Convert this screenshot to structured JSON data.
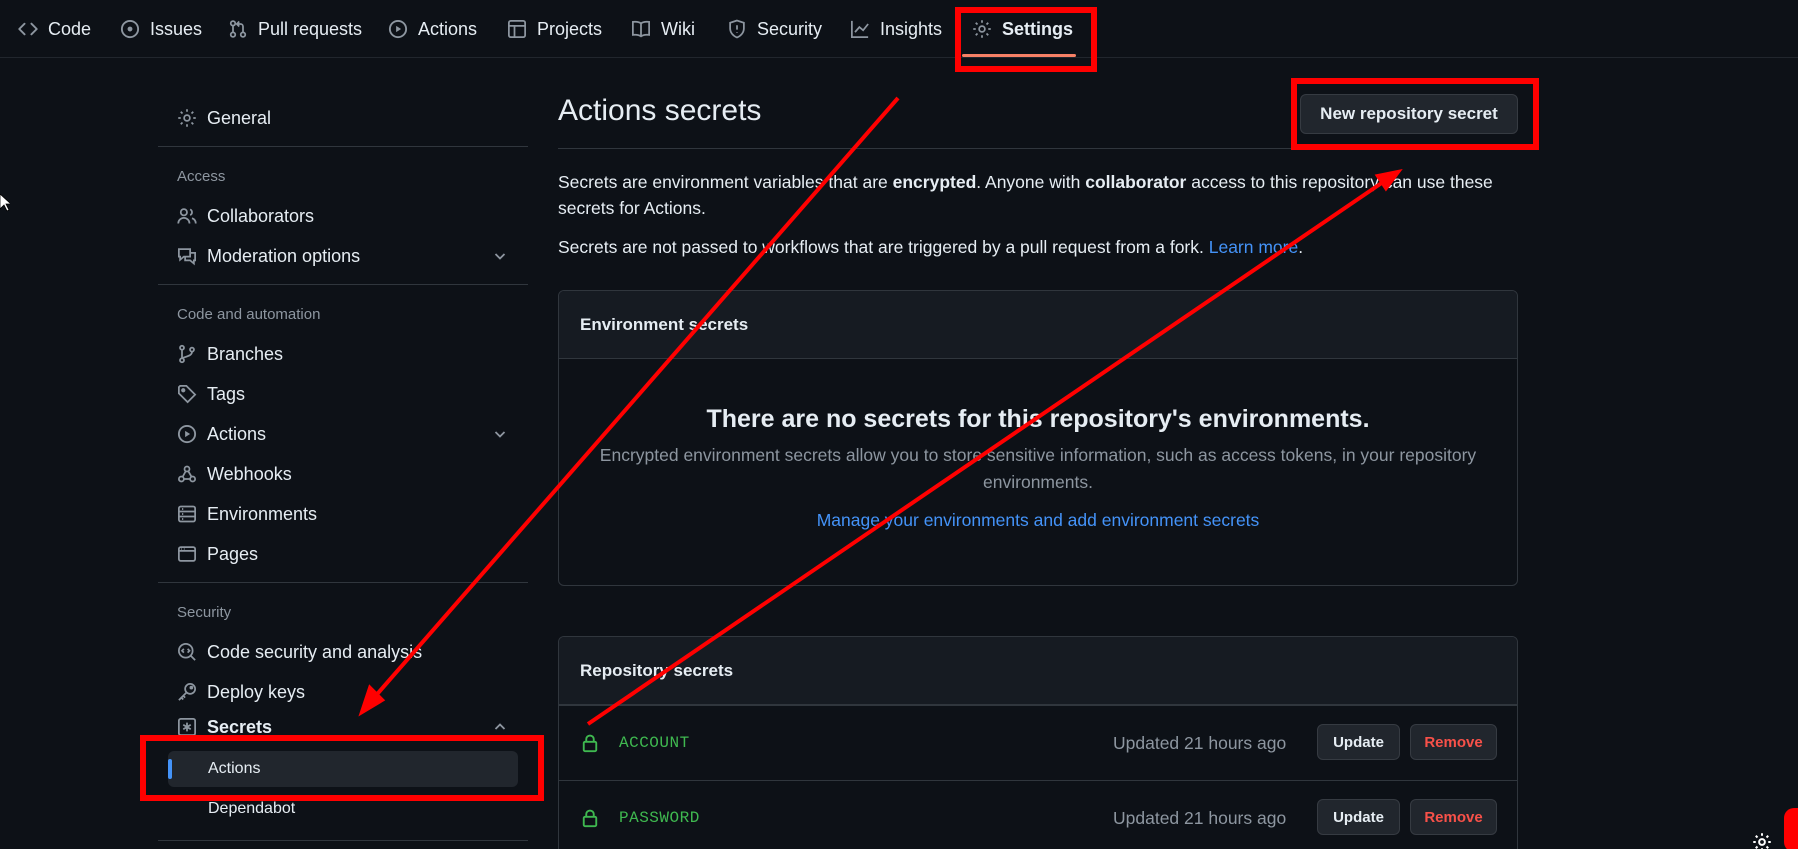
{
  "nav": {
    "tabs": [
      {
        "label": "Code",
        "icon": "code-icon"
      },
      {
        "label": "Issues",
        "icon": "issue-opened-icon"
      },
      {
        "label": "Pull requests",
        "icon": "git-pull-request-icon"
      },
      {
        "label": "Actions",
        "icon": "play-icon"
      },
      {
        "label": "Projects",
        "icon": "table-icon"
      },
      {
        "label": "Wiki",
        "icon": "book-icon"
      },
      {
        "label": "Security",
        "icon": "shield-icon"
      },
      {
        "label": "Insights",
        "icon": "graph-icon"
      },
      {
        "label": "Settings",
        "icon": "gear-icon",
        "active": true
      }
    ]
  },
  "sidebar": {
    "general": "General",
    "sections": {
      "access": "Access",
      "code_automation": "Code and automation",
      "security": "Security"
    },
    "access_items": [
      "Collaborators",
      "Moderation options"
    ],
    "code_items": [
      "Branches",
      "Tags",
      "Actions",
      "Webhooks",
      "Environments",
      "Pages"
    ],
    "security_items": [
      "Code security and analysis",
      "Deploy keys",
      "Secrets"
    ],
    "secrets_sub": [
      "Actions",
      "Dependabot"
    ],
    "active_sub": "Actions"
  },
  "main": {
    "title": "Actions secrets",
    "new_secret_button": "New repository secret",
    "desc1": {
      "part1": "Secrets are environment variables that are ",
      "bold1": "encrypted",
      "part2": ". Anyone with ",
      "bold2": "collaborator",
      "part3": " access to this repository can use these secrets for Actions."
    },
    "desc2": {
      "text": "Secrets are not passed to workflows that are triggered by a pull request from a fork. ",
      "link": "Learn more",
      "end": "."
    },
    "env_box": {
      "header": "Environment secrets",
      "blank_title": "There are no secrets for this repository's environments.",
      "blank_text": "Encrypted environment secrets allow you to store sensitive information, such as access tokens, in your repository environments.",
      "link": "Manage your environments and add environment secrets"
    },
    "repo_box": {
      "header": "Repository secrets",
      "rows": [
        {
          "name": "ACCOUNT",
          "updated": "Updated 21 hours ago",
          "update": "Update",
          "remove": "Remove"
        },
        {
          "name": "PASSWORD",
          "updated": "Updated 21 hours ago",
          "update": "Update",
          "remove": "Remove"
        }
      ]
    }
  },
  "colors": {
    "background": "#0d1117",
    "link": "#4493f8",
    "success": "#3fb950",
    "danger": "#f85149",
    "annotation": "#ff0000",
    "tab_underline": "#f78166"
  }
}
